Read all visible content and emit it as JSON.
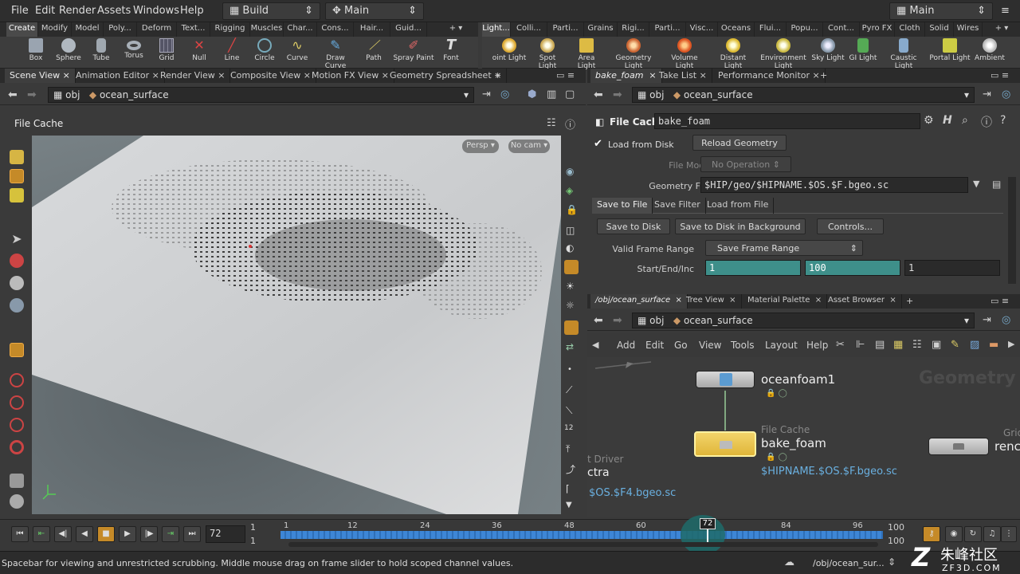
{
  "menubar": {
    "items": [
      "File",
      "Edit",
      "Render",
      "Assets",
      "Windows",
      "Help"
    ],
    "desktop": "Build",
    "network_view": "Main",
    "workspace": "Main"
  },
  "shelf_left": {
    "tabs": [
      "Create",
      "Modify",
      "Model",
      "Poly...",
      "Deform",
      "Text...",
      "Rigging",
      "Muscles",
      "Char...",
      "Cons...",
      "Hair...",
      "Guid..."
    ],
    "tools": [
      "Box",
      "Sphere",
      "Tube",
      "Torus",
      "Grid",
      "Null",
      "Line",
      "Circle",
      "Curve",
      "Draw Curve",
      "Path",
      "Spray Paint",
      "Font"
    ]
  },
  "shelf_right": {
    "tabs": [
      "Light...",
      "Colli...",
      "Parti...",
      "Grains",
      "Rigi...",
      "Parti...",
      "Visc...",
      "Oceans",
      "Flui...",
      "Popu...",
      "Cont...",
      "Pyro FX",
      "Cloth",
      "Solid",
      "Wires"
    ],
    "tools": [
      "oint Light",
      "Spot Light",
      "Area Light",
      "Geometry Light",
      "Volume Light",
      "Distant Light",
      "Environment Light",
      "Sky Light",
      "GI Light",
      "Caustic Light",
      "Portal Light",
      "Ambient"
    ]
  },
  "left_tabs": [
    "Scene View",
    "Animation Editor",
    "Render View",
    "Composite View",
    "Motion FX View",
    "Geometry Spreadsheet"
  ],
  "path": {
    "root": "obj",
    "node": "ocean_surface"
  },
  "viewport": {
    "operator": "File Cache",
    "camera": "Persp",
    "cam_menu": "No cam"
  },
  "param_tabs": [
    "bake_foam",
    "Take List",
    "Performance Monitor"
  ],
  "params": {
    "type": "File Cache",
    "name": "bake_foam",
    "load_from_disk": "Load from Disk",
    "reload": "Reload Geometry",
    "file_mode_label": "File Mode",
    "file_mode": "No Operation",
    "geo_file_label": "Geometry File",
    "geo_file": "$HIP/geo/$HIPNAME.$OS.$F.bgeo.sc",
    "subtabs": [
      "Save to File",
      "Save Filter",
      "Load from File"
    ],
    "save_disk": "Save to Disk",
    "save_bg": "Save to Disk in Background",
    "controls": "Controls...",
    "valid_label": "Valid Frame Range",
    "valid": "Save Frame Range",
    "range_label": "Start/End/Inc",
    "start": "1",
    "end": "100",
    "inc": "1"
  },
  "net_tabs": [
    "/obj/ocean_surface",
    "Tree View",
    "Material Palette",
    "Asset Browser"
  ],
  "net_menu": [
    "Add",
    "Edit",
    "Go",
    "View",
    "Tools",
    "Layout",
    "Help"
  ],
  "network": {
    "watermark": "Geometry",
    "node1": "oceanfoam1",
    "node2_type": "File Cache",
    "node2": "bake_foam",
    "node2_path": "$HIPNAME.$OS.$F.bgeo.sc",
    "left_type": "t Driver",
    "left_name": "ctra",
    "left_path": "$OS.$F4.bgeo.sc",
    "right_type": "Grid",
    "right_name": "renc"
  },
  "timeline": {
    "frame": "72",
    "start": "1",
    "start2": "1",
    "end": "100",
    "end2": "100",
    "ticks": [
      "1",
      "12",
      "24",
      "36",
      "48",
      "60",
      "72",
      "84",
      "96"
    ]
  },
  "status": {
    "message": "Spacebar for viewing and unrestricted scrubbing. Middle mouse drag on frame slider to hold scoped channel values.",
    "path": "/obj/ocean_sur..."
  },
  "watermark": {
    "site": "朱峰社区",
    "url": "ZF3D.COM"
  }
}
